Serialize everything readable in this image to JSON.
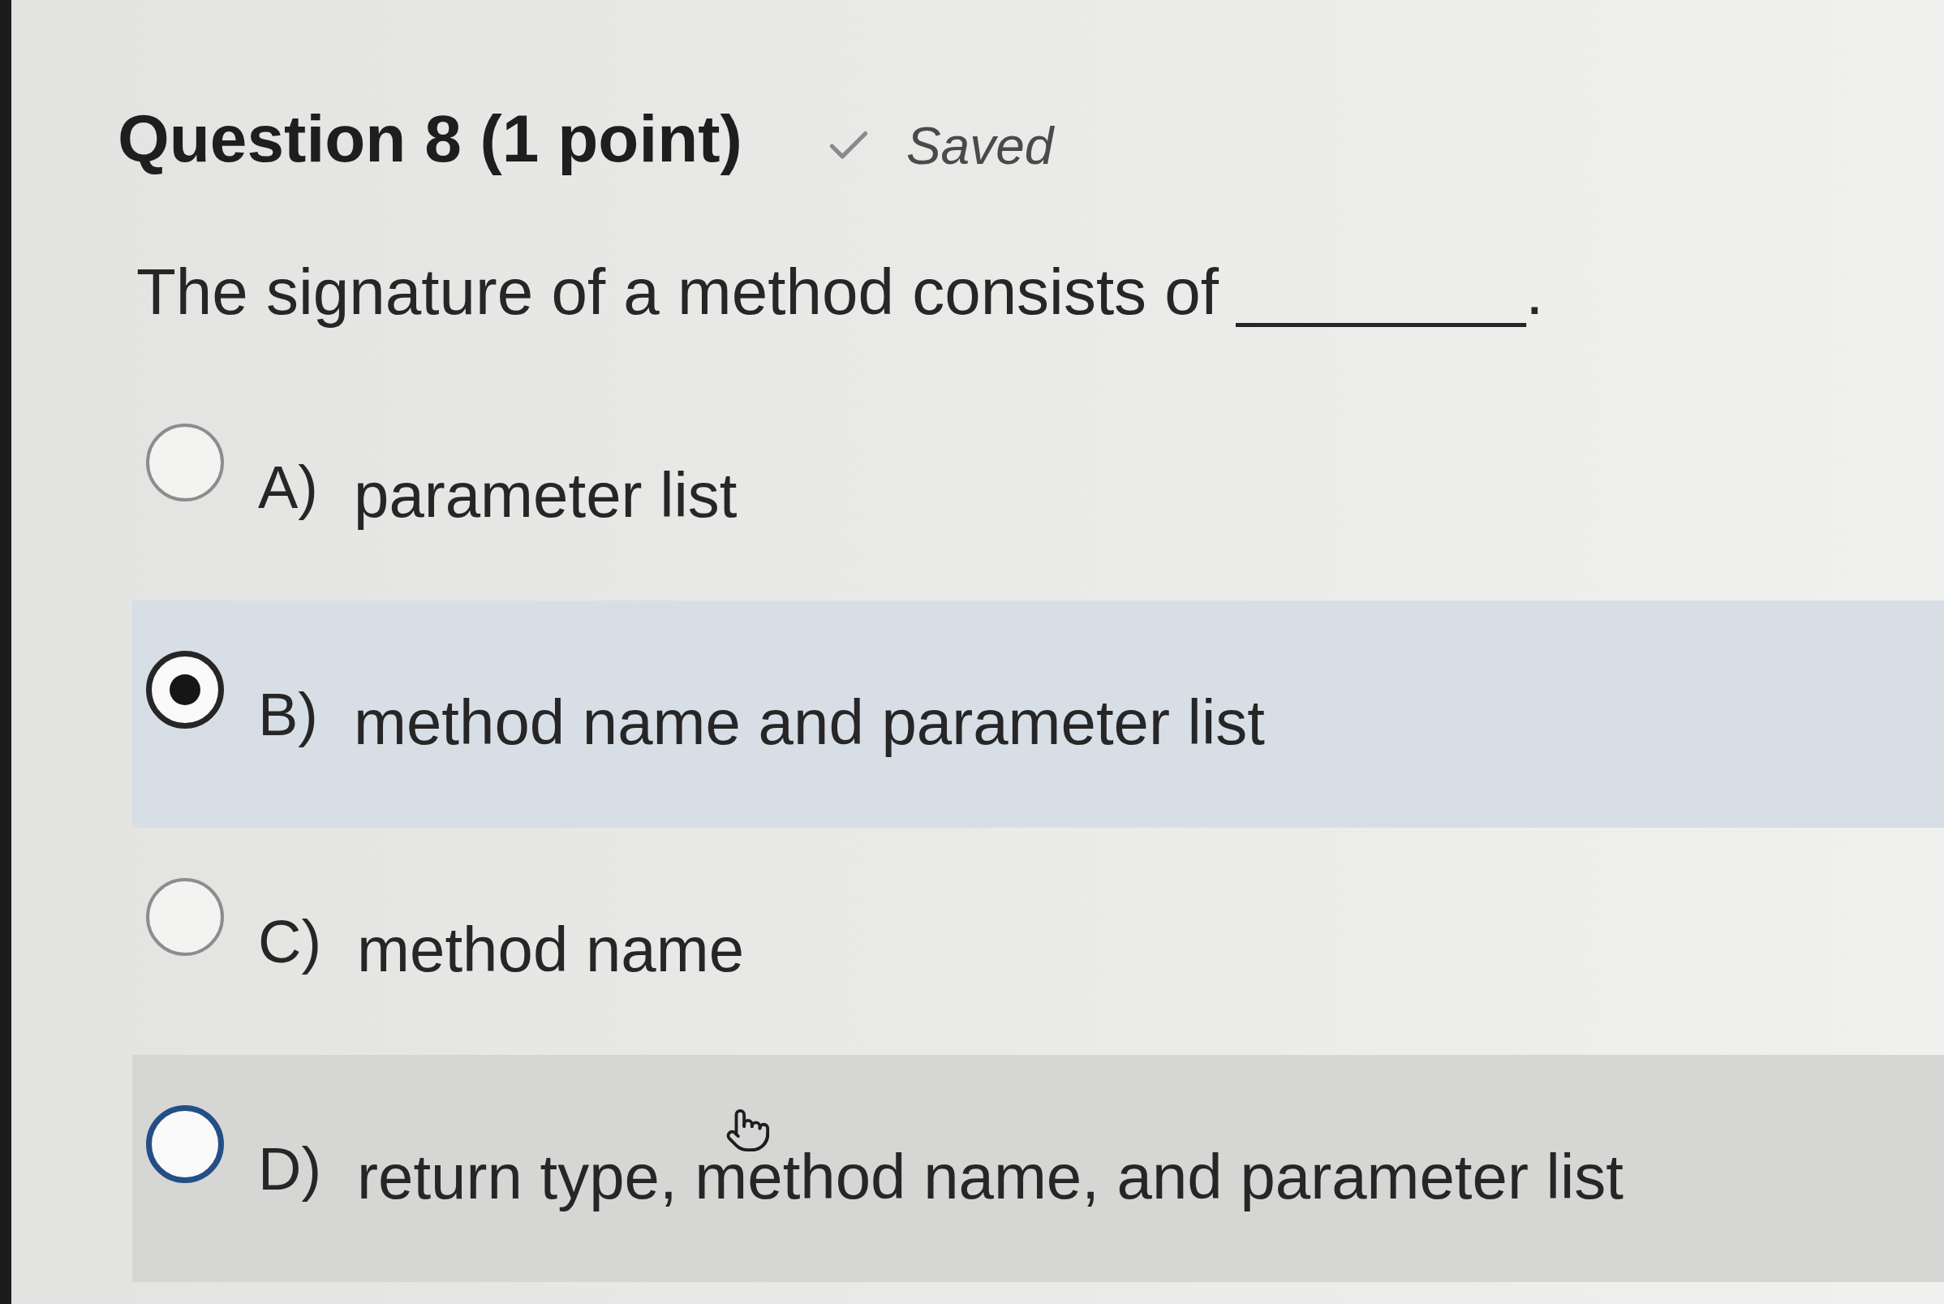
{
  "question": {
    "title": "Question 8 (1 point)",
    "status": {
      "label": "Saved",
      "saved": true
    },
    "prompt": "The signature of a method consists of ________."
  },
  "options": [
    {
      "letter": "A)",
      "text": "parameter list",
      "selected": false,
      "hovered": false
    },
    {
      "letter": "B)",
      "text": "method name and parameter list",
      "selected": true,
      "hovered": false
    },
    {
      "letter": "C)",
      "text": "method name",
      "selected": false,
      "hovered": false
    },
    {
      "letter": "D)",
      "text": "return type, method name, and parameter list",
      "selected": false,
      "hovered": true
    }
  ]
}
